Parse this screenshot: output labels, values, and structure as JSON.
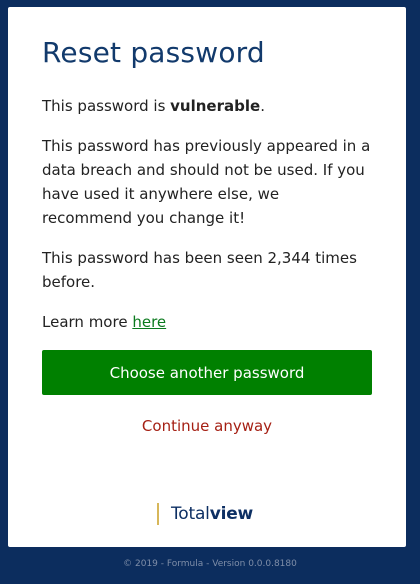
{
  "title": "Reset password",
  "status": {
    "prefix": "This password is ",
    "emphasis": "vulnerable",
    "suffix": "."
  },
  "breach_message": "This password has previously appeared in a data breach and should not be used. If you have used it anywhere else, we recommend you change it!",
  "seen_message": "This password has been seen 2,344 times before.",
  "learn_more": {
    "prefix": "Learn more ",
    "link_label": "here"
  },
  "buttons": {
    "primary_label": "Choose another password",
    "secondary_label": "Continue anyway"
  },
  "logo": {
    "part1": "Total",
    "part2": "view"
  },
  "footer": "© 2019 - Formula - Version 0.0.0.8180",
  "colors": {
    "background": "#0c2d5e",
    "primary_button": "#008000",
    "secondary_link": "#a52014",
    "title": "#123a6c",
    "logo_accent": "#d7b75a"
  }
}
